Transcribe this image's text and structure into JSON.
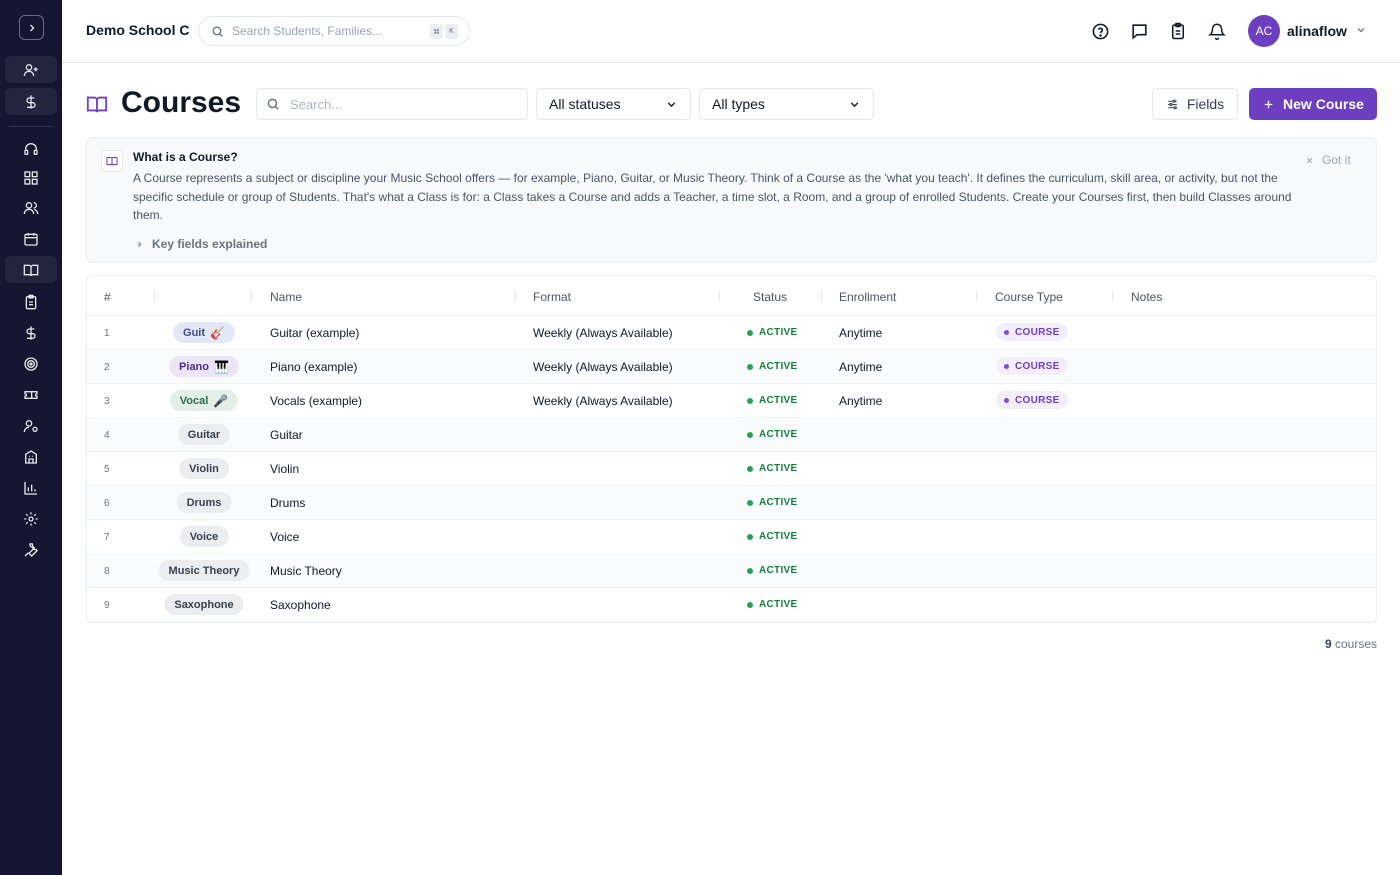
{
  "header": {
    "school_name": "Demo School C",
    "search_placeholder": "Search Students, Families...",
    "kbd_1": "⌘",
    "kbd_2": "K",
    "user_initials": "AC",
    "user_name": "alinaflow"
  },
  "sidebar": {
    "items": [
      {
        "icon": "user-plus-icon"
      },
      {
        "icon": "dollar-icon"
      },
      {
        "icon": "headset-icon"
      },
      {
        "icon": "dashboard-icon"
      },
      {
        "icon": "users-icon"
      },
      {
        "icon": "calendar-icon"
      },
      {
        "icon": "book-icon"
      },
      {
        "icon": "clipboard-icon"
      },
      {
        "icon": "dollar-icon"
      },
      {
        "icon": "target-icon"
      },
      {
        "icon": "ticket-icon"
      },
      {
        "icon": "user-settings-icon"
      },
      {
        "icon": "building-icon"
      },
      {
        "icon": "chart-icon"
      },
      {
        "icon": "gear-icon"
      },
      {
        "icon": "wrench-icon"
      }
    ]
  },
  "page": {
    "title": "Courses",
    "search_placeholder": "Search...",
    "status_filter": "All statuses",
    "type_filter": "All types",
    "fields_button": "Fields",
    "new_button": "New Course"
  },
  "info": {
    "title": "What is a Course?",
    "text": "A Course represents a subject or discipline your Music School offers — for example, Piano, Guitar, or Music Theory. Think of a Course as the 'what you teach'. It defines the curriculum, skill area, or activity, but not the specific schedule or group of Students. That's what a Class is for: a Class takes a Course and adds a Teacher, a time slot, a Room, and a group of enrolled Students. Create your Courses first, then build Classes around them.",
    "dismiss": "Got it",
    "key_fields": "Key fields explained"
  },
  "table": {
    "columns": [
      "#",
      "",
      "Name",
      "Format",
      "Status",
      "Enrollment",
      "Course Type",
      "Notes"
    ],
    "rows": [
      {
        "num": "1",
        "tag": "Guit",
        "emoji": "🎸",
        "name": "Guitar (example)",
        "format": "Weekly (Always Available)",
        "status": "ACTIVE",
        "enrollment": "Anytime",
        "course_type": "COURSE"
      },
      {
        "num": "2",
        "tag": "Piano",
        "emoji": "🎹",
        "name": "Piano (example)",
        "format": "Weekly (Always Available)",
        "status": "ACTIVE",
        "enrollment": "Anytime",
        "course_type": "COURSE"
      },
      {
        "num": "3",
        "tag": "Vocal",
        "emoji": "🎤",
        "name": "Vocals (example)",
        "format": "Weekly (Always Available)",
        "status": "ACTIVE",
        "enrollment": "Anytime",
        "course_type": "COURSE"
      },
      {
        "num": "4",
        "tag": "Guitar",
        "emoji": "",
        "name": "Guitar",
        "format": "",
        "status": "ACTIVE",
        "enrollment": "",
        "course_type": ""
      },
      {
        "num": "5",
        "tag": "Violin",
        "emoji": "",
        "name": "Violin",
        "format": "",
        "status": "ACTIVE",
        "enrollment": "",
        "course_type": ""
      },
      {
        "num": "6",
        "tag": "Drums",
        "emoji": "",
        "name": "Drums",
        "format": "",
        "status": "ACTIVE",
        "enrollment": "",
        "course_type": ""
      },
      {
        "num": "7",
        "tag": "Voice",
        "emoji": "",
        "name": "Voice",
        "format": "",
        "status": "ACTIVE",
        "enrollment": "",
        "course_type": ""
      },
      {
        "num": "8",
        "tag": "Music Theory",
        "emoji": "",
        "name": "Music Theory",
        "format": "",
        "status": "ACTIVE",
        "enrollment": "",
        "course_type": ""
      },
      {
        "num": "9",
        "tag": "Saxophone",
        "emoji": "",
        "name": "Saxophone",
        "format": "",
        "status": "ACTIVE",
        "enrollment": "",
        "course_type": ""
      }
    ]
  },
  "footer": {
    "count": "9",
    "count_label": "courses"
  }
}
